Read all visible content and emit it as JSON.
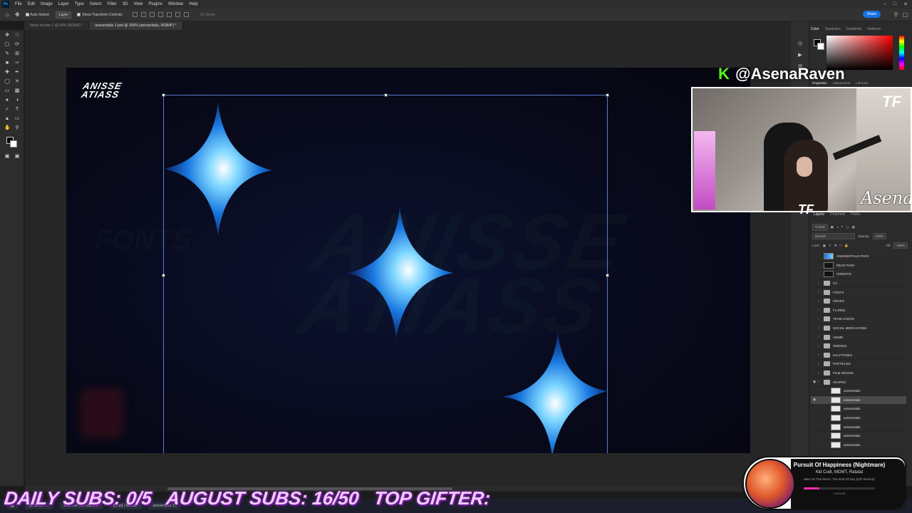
{
  "app": {
    "logo": "Ps",
    "menu": [
      "File",
      "Edit",
      "Image",
      "Layer",
      "Type",
      "Select",
      "Filter",
      "3D",
      "View",
      "Plugins",
      "Window",
      "Help"
    ]
  },
  "options": {
    "auto_select": "Auto-Select:",
    "auto_select_target": "Layer",
    "show_transform": "Show Transform Controls",
    "mode_3d": "3D Mode:",
    "share": "Share"
  },
  "tabs": [
    {
      "label": "booty header 1 @ 50% (RGB/8) *",
      "active": false
    },
    {
      "label": "anissentials 1.psd @ 100% (anissentials, RGB/8*) *",
      "active": true
    }
  ],
  "canvas": {
    "logo_line1": "ANISSE",
    "logo_line2": "ATIASS",
    "bg_text_line1": "ANISSE",
    "bg_text_line2": "ATIASS",
    "bg_fonts": "FONTS"
  },
  "colors": {
    "accent": "#1473e6",
    "kick": "#53fc18",
    "subs": "#f4c8ff"
  },
  "color_panel": {
    "tabs": [
      {
        "label": "Color",
        "on": true
      },
      {
        "label": "Swatches",
        "on": false
      },
      {
        "label": "Gradients",
        "on": false
      },
      {
        "label": "Patterns",
        "on": false
      }
    ]
  },
  "properties_panel": {
    "tabs": [
      {
        "label": "Properties",
        "on": true
      },
      {
        "label": "Adjustments",
        "on": false
      },
      {
        "label": "Libraries",
        "on": false
      }
    ]
  },
  "layers_panel": {
    "tabs": [
      {
        "label": "Layers",
        "on": true
      },
      {
        "label": "Channels",
        "on": false
      },
      {
        "label": "Paths",
        "on": false
      }
    ],
    "filter": "Kind",
    "blend": "Normal",
    "opacity_label": "Opacity:",
    "opacity": "100%",
    "lock_label": "Lock:",
    "fill_label": "Fill:",
    "fill": "100%",
    "layers": [
      {
        "name": "ANISSENTIALS PACK",
        "kind": "grad",
        "eye": false,
        "selected": false
      },
      {
        "name": "READ THIS!",
        "kind": "dark",
        "eye": false,
        "selected": false
      },
      {
        "name": "CREDITS!",
        "kind": "dark",
        "eye": false,
        "selected": false
      },
      {
        "name": "CC",
        "kind": "folder",
        "eye": false,
        "selected": false
      },
      {
        "name": "FONTS",
        "kind": "folder",
        "eye": false,
        "selected": false
      },
      {
        "name": "ORAPS",
        "kind": "folder",
        "eye": false,
        "selected": false
      },
      {
        "name": "FLARES",
        "kind": "folder",
        "eye": false,
        "selected": false
      },
      {
        "name": "TEAM LOGOS",
        "kind": "folder",
        "eye": false,
        "selected": false
      },
      {
        "name": "SOCIAL MEDIA ICONS",
        "kind": "folder",
        "eye": false,
        "selected": false
      },
      {
        "name": "ANIME",
        "kind": "folder",
        "eye": false,
        "selected": false
      },
      {
        "name": "SMOKES",
        "kind": "folder",
        "eye": false,
        "selected": false
      },
      {
        "name": "HALFTONES",
        "kind": "folder",
        "eye": false,
        "selected": false
      },
      {
        "name": "PARTICLES",
        "kind": "folder",
        "eye": false,
        "selected": false
      },
      {
        "name": "FILM GRAINS",
        "kind": "folder",
        "eye": false,
        "selected": false
      },
      {
        "name": "SHAPES",
        "kind": "folder",
        "eye": true,
        "selected": false
      },
      {
        "name": "anissentials",
        "kind": "thumb",
        "eye": false,
        "selected": false
      },
      {
        "name": "anissentials",
        "kind": "thumb",
        "eye": true,
        "selected": true
      },
      {
        "name": "anissentials",
        "kind": "thumb",
        "eye": false,
        "selected": false
      },
      {
        "name": "anissentials",
        "kind": "thumb",
        "eye": false,
        "selected": false
      },
      {
        "name": "anissentials",
        "kind": "thumb",
        "eye": false,
        "selected": false
      },
      {
        "name": "anissentials",
        "kind": "thumb",
        "eye": false,
        "selected": false
      },
      {
        "name": "anissentials",
        "kind": "thumb",
        "eye": false,
        "selected": false
      }
    ]
  },
  "stream": {
    "kick_handle": "@AsenaRaven",
    "signature": "Asena",
    "tf_logo": "TF",
    "subs_daily": "DAILY SUBS: 0/5",
    "subs_month": "AUGUST SUBS: 16/50",
    "top_gifter": "TOP GIFTER:"
  },
  "now_playing": {
    "title": "Pursuit Of Happiness (Nightmare)",
    "artist": "Kid Cudi, MGMT, Ratatat",
    "album": "Man On The Moon: The End Of Day (Int'l Version)",
    "progress": 0.22,
    "time": "0:53/4:55"
  },
  "taskbar": {
    "items": [
      "(3) Booty H...",
      "2023 Ge...file Explorer",
      "[Chat] | Asena...",
      "anissentials 1..."
    ]
  }
}
